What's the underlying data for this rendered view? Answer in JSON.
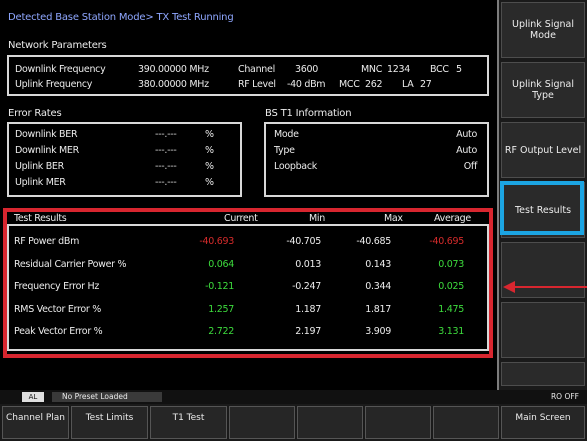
{
  "title": "Detected Base Station Mode> TX Test Running",
  "network": {
    "heading": "Network Parameters",
    "row1": {
      "label": "Downlink Frequency",
      "freq": "390.00000 MHz",
      "channel_label": "Channel",
      "channel": "3600",
      "mnc_label": "MNC",
      "mnc": "1234",
      "bcc_label": "BCC",
      "bcc": "5"
    },
    "row2": {
      "label": "Uplink Frequency",
      "freq": "380.00000 MHz",
      "rflevel_label": "RF Level",
      "rflevel": "-40 dBm",
      "mcc_label": "MCC",
      "mcc": "262",
      "la_label": "LA",
      "la": "27"
    }
  },
  "error_rates": {
    "heading": "Error Rates",
    "rows": [
      {
        "label": "Downlink BER",
        "value": "---.---",
        "unit": "%"
      },
      {
        "label": "Downlink MER",
        "value": "---.---",
        "unit": "%"
      },
      {
        "label": "Uplink BER",
        "value": "---.---",
        "unit": "%"
      },
      {
        "label": "Uplink MER",
        "value": "---.---",
        "unit": "%"
      }
    ]
  },
  "bs_info": {
    "heading": "BS T1 Information",
    "rows": [
      {
        "label": "Mode",
        "value": "Auto"
      },
      {
        "label": "Type",
        "value": "Auto"
      },
      {
        "label": "Loopback",
        "value": "Off"
      }
    ]
  },
  "test_results": {
    "headers": {
      "name": "Test Results",
      "current": "Current",
      "min": "Min",
      "max": "Max",
      "average": "Average"
    },
    "rows": [
      {
        "name": "RF Power dBm",
        "current": "-40.693",
        "min": "-40.705",
        "max": "-40.685",
        "average": "-40.695",
        "status": "fail"
      },
      {
        "name": "Residual Carrier Power %",
        "current": "0.064",
        "min": "0.013",
        "max": "0.143",
        "average": "0.073",
        "status": "pass"
      },
      {
        "name": "Frequency Error Hz",
        "current": "-0.121",
        "min": "-0.247",
        "max": "0.344",
        "average": "0.025",
        "status": "pass"
      },
      {
        "name": "RMS Vector Error %",
        "current": "1.257",
        "min": "1.187",
        "max": "1.817",
        "average": "1.475",
        "status": "pass"
      },
      {
        "name": "Peak Vector Error %",
        "current": "2.722",
        "min": "2.197",
        "max": "3.909",
        "average": "3.131",
        "status": "pass"
      }
    ]
  },
  "soft_keys": {
    "uplink_mode": "Uplink Signal Mode",
    "uplink_type": "Uplink Signal Type",
    "rf_output": "RF Output Level",
    "test_results": "Test Results"
  },
  "status": {
    "mode": "AL",
    "preset": "No Preset Loaded",
    "right": "RO OFF"
  },
  "bottom_keys": [
    "Channel Plan",
    "Test Limits",
    "T1 Test",
    "",
    "",
    "",
    "",
    "Main Screen"
  ],
  "colors": {
    "pass": "#3ddc3d",
    "fail": "#d52b2b",
    "highlight_red": "#d8262f",
    "highlight_blue": "#1ca5e3",
    "arrow": "#d8262f"
  }
}
